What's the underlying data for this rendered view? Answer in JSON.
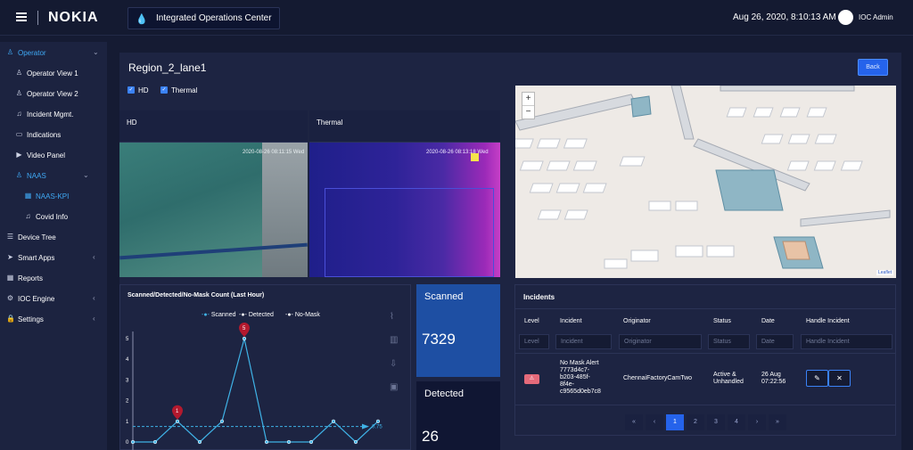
{
  "header": {
    "brand": "NOKIA",
    "app_title": "Integrated Operations Center",
    "datetime": "Aug 26, 2020, 8:10:13 AM",
    "user": "IOC Admin"
  },
  "sidebar": {
    "items": [
      {
        "label": "Operator",
        "icon": "person-icon"
      },
      {
        "label": "Operator View 1",
        "icon": "person-icon"
      },
      {
        "label": "Operator View 2",
        "icon": "person-icon"
      },
      {
        "label": "Incident Mgmt.",
        "icon": "bell-icon"
      },
      {
        "label": "Indications",
        "icon": "card-icon"
      },
      {
        "label": "Video Panel",
        "icon": "play-icon"
      },
      {
        "label": "NAAS",
        "icon": "person-icon"
      },
      {
        "label": "NAAS-KPI",
        "icon": "dashboard-icon"
      },
      {
        "label": "Covid Info",
        "icon": "bell-icon"
      },
      {
        "label": "Device Tree",
        "icon": "list-icon"
      },
      {
        "label": "Smart Apps",
        "icon": "send-icon"
      },
      {
        "label": "Reports",
        "icon": "grid-icon"
      },
      {
        "label": "IOC Engine",
        "icon": "gear-icon"
      },
      {
        "label": "Settings",
        "icon": "lock-icon"
      }
    ]
  },
  "page": {
    "title": "Region_2_lane1",
    "back_label": "Back",
    "checkbox_hd": "HD",
    "checkbox_thermal": "Thermal"
  },
  "cameras": {
    "hd_title": "HD",
    "hd_timestamp": "2020-08-26 08:11:15 Wed",
    "thermal_title": "Thermal",
    "thermal_timestamp": "2020-08-26 08:13:18 Wed"
  },
  "map": {
    "zoom_in": "+",
    "zoom_out": "−",
    "attribution": "Leaflet"
  },
  "chart_data": {
    "type": "line",
    "title": "Scanned/Detected/No-Mask Count (Last Hour)",
    "ylim": [
      0,
      5
    ],
    "y_ticks": [
      "0",
      "1",
      "2",
      "3",
      "4",
      "5"
    ],
    "series": [
      {
        "name": "Scanned",
        "values": [
          0,
          0,
          1,
          0,
          1,
          5,
          0,
          0,
          0,
          1,
          0,
          1
        ]
      },
      {
        "name": "Detected",
        "values": []
      },
      {
        "name": "No-Mask",
        "values": []
      }
    ],
    "markers": [
      {
        "label": "5",
        "index": 5
      },
      {
        "label": "1",
        "index": 2
      }
    ],
    "threshold_label": "0.75",
    "threshold": 0.75,
    "colors": {
      "scanned": "#3fb2e6",
      "threshold": "#3fb2e6",
      "marker": "#b3192e"
    }
  },
  "kpis": {
    "scanned_label": "Scanned",
    "scanned_value": "7329",
    "detected_label": "Detected",
    "detected_value": "26"
  },
  "incidents": {
    "title": "Incidents",
    "columns": [
      "Level",
      "Incident",
      "Originator",
      "Status",
      "Date",
      "Handle Incident"
    ],
    "filters": [
      "Level",
      "Incident",
      "Originator",
      "Status",
      "Date",
      "Handle Incident"
    ],
    "row": {
      "level": "⚠",
      "incident": [
        "No Mask Alert",
        "7773d4c7-",
        "b203-485f-",
        "8f4e-",
        "c9565d0eb7c8"
      ],
      "originator": "ChennaiFactoryCamTwo",
      "status": [
        "Active &",
        "Unhandled"
      ],
      "date": [
        "26 Aug",
        "07:22:56"
      ]
    },
    "pagination": [
      "«",
      "‹",
      "1",
      "2",
      "3",
      "4",
      "›",
      "»"
    ]
  }
}
